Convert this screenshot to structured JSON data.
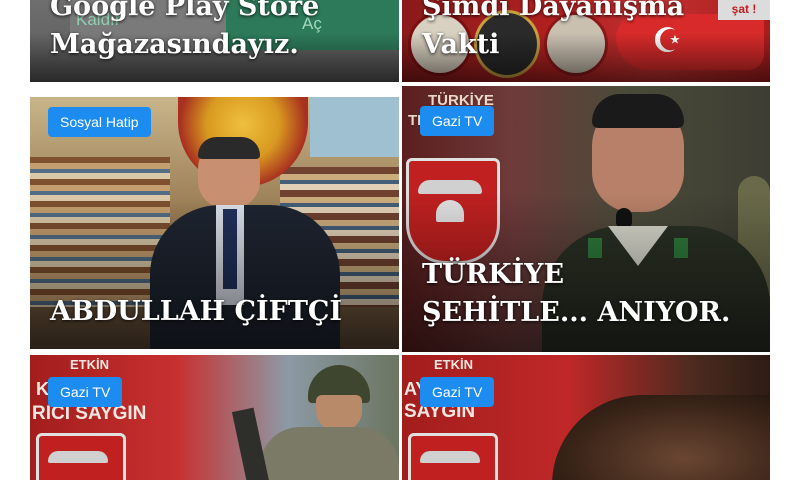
{
  "cards": [
    {
      "title_line1": "Google Play Store",
      "title_line2": "Mağazasındayız.",
      "overlay_left": "Kaldır",
      "overlay_right": "Aç"
    },
    {
      "title_line1": "Şimdi Dayanışma",
      "title_line2": "Vakti",
      "corner_tag": "şat !"
    },
    {
      "badge": "Sosyal Hatip",
      "title_line1": "ABDULLAH ÇİFTÇİ"
    },
    {
      "badge": "Gazi TV",
      "bg_text_top": "TÜRKİYE",
      "bg_text_second": "TLE... R",
      "title_line1": "TÜRKİYE",
      "title_line2": "ŞEHİTLE... ANIYOR."
    },
    {
      "badge": "Gazi TV",
      "bg_text_top": "ETKİN",
      "bg_text_second": "RICI SAYGIN",
      "bg_text_left": "K"
    },
    {
      "badge": "Gazi TV",
      "bg_text_top": "ETKİN",
      "bg_text_second": "AY",
      "bg_text_third": "SAYGIN"
    }
  ],
  "colors": {
    "badge": "#1d8cf0",
    "title_text": "#ffffff"
  }
}
